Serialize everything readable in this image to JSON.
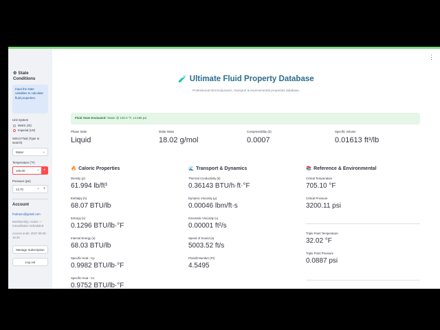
{
  "menu_icon": "kebab-menu-icon",
  "sidebar": {
    "title": "State Conditions",
    "info": "Input the state variables to calculate fluid properties.",
    "unit_system_label": "Unit System",
    "unit_options": [
      "Metric (SI)",
      "Imperial (US)"
    ],
    "unit_selected": "Imperial (US)",
    "fluid_label": "Select Fluid (Type to search)",
    "fluid_value": "Water",
    "temperature_label": "Temperature (°F)",
    "temperature_value": "100.00",
    "pressure_label": "Pressure (psi)",
    "pressure_value": "14.70",
    "account_heading": "Account",
    "email": "frodnazo@gmail.com",
    "membership": "Membership: Active — Cancellation Scheduled",
    "access": "Access ends: 2027-08-06 15:32",
    "manage_button": "Manage Subscription",
    "logout_button": "Log out"
  },
  "main": {
    "title": "Ultimate Fluid Property Database",
    "subtitle": "Professional thermodynamic, transport & environmental properties database.",
    "state_label": "Fluid State Evaluated:",
    "state_text": "Water @ 100.0 °F, 14.696 psi",
    "top_metrics": [
      {
        "label": "Phase State",
        "value": "Liquid"
      },
      {
        "label": "Molar Mass",
        "value": "18.02 g/mol"
      },
      {
        "label": "Compressibility (Z)",
        "value": "0.0007"
      },
      {
        "label": "Specific Volume",
        "value": "0.01613 ft³/lb"
      }
    ],
    "sections": [
      {
        "heading": "Caloric Properties",
        "icon": "fire-icon",
        "metrics": [
          {
            "label": "Density (ρ)",
            "value": "61.994 lb/ft³"
          },
          {
            "label": "Enthalpy (h)",
            "value": "68.07 BTU/lb"
          },
          {
            "label": "Entropy (s)",
            "value": "0.1296 BTU/lb·°F"
          },
          {
            "label": "Internal Energy (u)",
            "value": "68.03 BTU/lb"
          },
          {
            "label": "Specific Heat - Cp",
            "value": "0.9982 BTU/lb·°F"
          },
          {
            "label": "Specific Heat - Cv",
            "value": "0.9752 BTU/lb·°F"
          }
        ]
      },
      {
        "heading": "Transport & Dynamics",
        "icon": "wave-icon",
        "metrics": [
          {
            "label": "Thermal Conductivity (k)",
            "value": "0.36143 BTU/h·ft·°F"
          },
          {
            "label": "Dynamic Viscosity (μ)",
            "value": "0.00046 lbm/ft·s"
          },
          {
            "label": "Kinematic Viscosity (ν)",
            "value": "0.00001 ft²/s"
          },
          {
            "label": "Speed of Sound (a)",
            "value": "5003.52 ft/s"
          },
          {
            "label": "Prandtl Number (Pr)",
            "value": "4.5495"
          }
        ]
      },
      {
        "heading": "Reference & Environmental",
        "icon": "books-icon",
        "metrics": [
          {
            "label": "Critical Temperature",
            "value": "705.10 °F"
          },
          {
            "label": "Critical Pressure",
            "value": "3200.11 psi"
          },
          {
            "label": "Triple Point Temperature",
            "value": "32.02 °F"
          },
          {
            "label": "Triple Point Pressure",
            "value": "0.0887 psi"
          }
        ]
      }
    ]
  }
}
